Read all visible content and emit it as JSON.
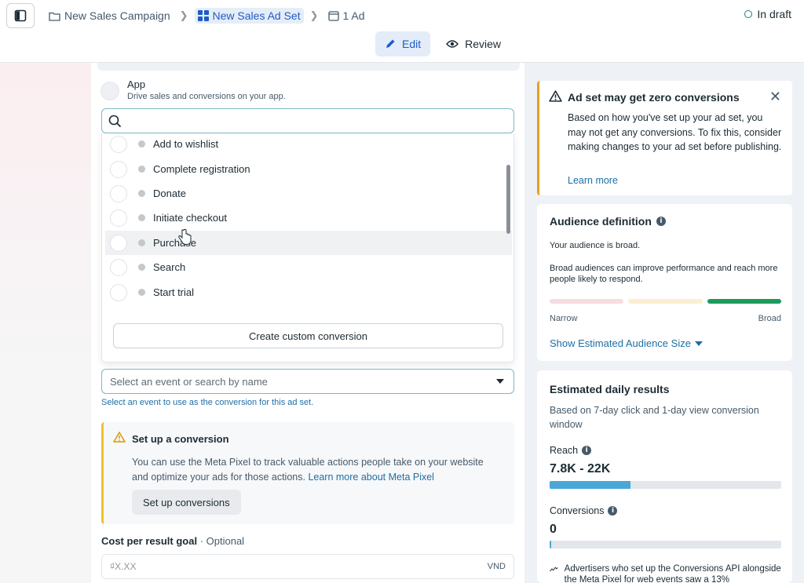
{
  "header": {
    "crumbs": [
      {
        "label": "New Sales Campaign",
        "icon": "folder-icon"
      },
      {
        "label": "New Sales Ad Set",
        "icon": "grid-icon"
      },
      {
        "label": "1 Ad",
        "icon": "ad-icon"
      }
    ],
    "status": "In draft",
    "modes": {
      "edit": "Edit",
      "review": "Review"
    }
  },
  "app_option": {
    "title": "App",
    "description": "Drive sales and conversions on your app."
  },
  "search": {
    "value": "",
    "placeholder": ""
  },
  "dropdown": {
    "options": [
      "Add to wishlist",
      "Complete registration",
      "Donate",
      "Initiate checkout",
      "Purchase",
      "Search",
      "Start trial"
    ],
    "custom_button": "Create custom conversion"
  },
  "event_select": {
    "placeholder": "Select an event or search by name",
    "help": "Select an event to use as the conversion for this ad set."
  },
  "setup": {
    "title": "Set up a conversion",
    "body": "You can use the Meta Pixel to track valuable actions people take on your website and optimize your ads for those actions.",
    "link": "Learn more about Meta Pixel",
    "button": "Set up conversions"
  },
  "cost": {
    "label": "Cost per result goal",
    "optional": "· Optional",
    "placeholder": "₫X.XX",
    "currency": "VND"
  },
  "warning": {
    "title": "Ad set may get zero conversions",
    "body": "Based on how you've set up your ad set, you may not get any conversions. To fix this, consider making changes to your ad set before publishing.",
    "link": "Learn more"
  },
  "audience": {
    "title": "Audience definition",
    "summary": "Your audience is broad.",
    "detail": "Broad audiences can improve performance and reach more people likely to respond.",
    "narrow": "Narrow",
    "broad": "Broad",
    "link": "Show Estimated Audience Size",
    "colors": {
      "narrow": "#f6dde1",
      "mid": "#fbefd2",
      "broad": "#1e9a5c"
    }
  },
  "estimates": {
    "title": "Estimated daily results",
    "subtitle": "Based on 7-day click and 1-day view conversion window",
    "reach_label": "Reach",
    "reach_value": "7.8K - 22K",
    "reach_fraction": 0.35,
    "conversions_label": "Conversions",
    "conversions_value": "0",
    "conversions_fraction": 0.005,
    "footnote": "Advertisers who set up the Conversions API alongside the Meta Pixel for web events saw a 13%"
  }
}
